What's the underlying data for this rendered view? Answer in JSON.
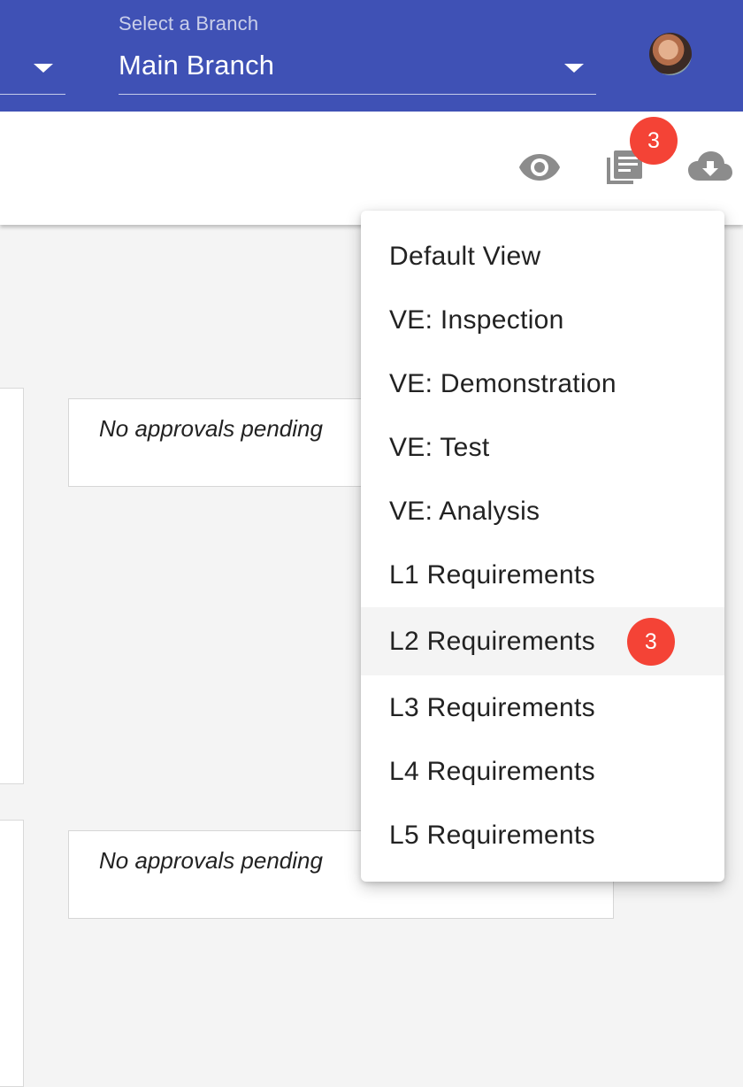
{
  "header": {
    "branch_label": "Select a Branch",
    "branch_value": "Main Branch",
    "colors": {
      "appbar": "#3f51b5"
    }
  },
  "toolbar": {
    "icons": [
      "eye-icon",
      "library-icon",
      "cloud-download-icon"
    ],
    "badge_count": "3",
    "colors": {
      "badge": "#f44336",
      "icon": "#8c8c8c"
    }
  },
  "content": {
    "approvals": [
      {
        "text": "No approvals pending"
      },
      {
        "text": "No approvals pending"
      }
    ]
  },
  "view_menu": {
    "items": [
      {
        "label": "Default View"
      },
      {
        "label": "VE: Inspection"
      },
      {
        "label": "VE: Demonstration"
      },
      {
        "label": "VE: Test"
      },
      {
        "label": "VE: Analysis"
      },
      {
        "label": "L1 Requirements"
      },
      {
        "label": "L2 Requirements",
        "badge": "3"
      },
      {
        "label": "L3 Requirements"
      },
      {
        "label": "L4 Requirements"
      },
      {
        "label": "L5 Requirements"
      }
    ],
    "active_label": "L2 Requirements"
  }
}
